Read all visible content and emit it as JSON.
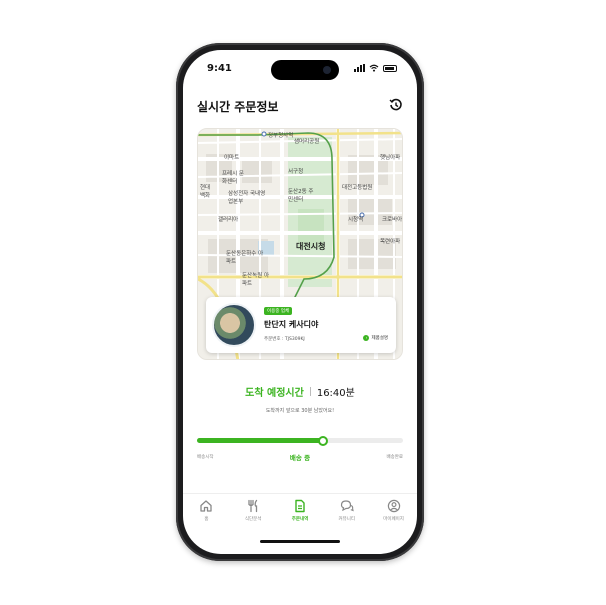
{
  "status_bar": {
    "time": "9:41"
  },
  "header": {
    "title": "실시간 주문정보",
    "history_icon": "history-icon"
  },
  "map": {
    "labels": [
      "정부청사역",
      "이마트",
      "프레시 문화센터",
      "삼성전자 국내영업본부",
      "갤러리아",
      "현대 백화",
      "서구청",
      "둔산2동 주민센터",
      "대전고등법원",
      "시청역",
      "대전시청",
      "둔산동은하수 아파트",
      "둔산녹원 아파트",
      "크로바아",
      "목련아파",
      "햇님아파",
      "샘머리공원"
    ]
  },
  "order_card": {
    "badge": "이용중 업체",
    "store_name": "탄단지 케사디야",
    "order_number": "주문번호 : TJS309KJ",
    "detail_link": "제품설명"
  },
  "eta": {
    "label": "도착 예정시간",
    "time": "16:40분",
    "remaining": "도착까지 앞으로 30분 남았어요!"
  },
  "progress": {
    "percent": 61,
    "steps": [
      "배송시작",
      "배송 중",
      "배송완료"
    ]
  },
  "tabs": [
    {
      "label": "홈",
      "icon": "home-icon",
      "active": false
    },
    {
      "label": "식단분석",
      "icon": "fork-knife-icon",
      "active": false
    },
    {
      "label": "주문내역",
      "icon": "document-icon",
      "active": true
    },
    {
      "label": "커뮤니티",
      "icon": "chat-icon",
      "active": false
    },
    {
      "label": "마이페이지",
      "icon": "user-icon",
      "active": false
    }
  ],
  "colors": {
    "accent": "#3cb421",
    "text": "#111111",
    "muted": "#888888"
  }
}
